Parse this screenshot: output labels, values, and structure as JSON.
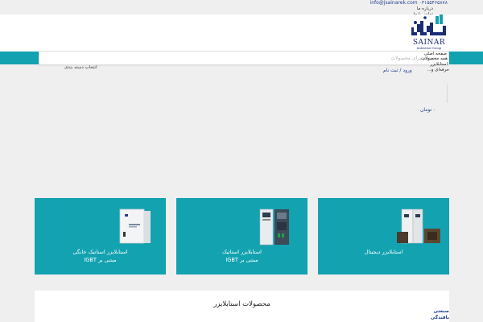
{
  "topbar": {
    "contact": "info@jsainarek.com ۰۳۱۵۵۴۶۵۸۷۸",
    "about_link": "درباره ما",
    "contact_link": "تماس با ما"
  },
  "logo": {
    "brand": "SAINAR",
    "tagline": "Industrial Group"
  },
  "search": {
    "placeholder": "جستجو برای محصولات"
  },
  "nav": {
    "home": "صفحه اصلی",
    "all_products": "همه محصولات",
    "stabilizer": "استابلایزر",
    "professional": "حرفه‌ای و..."
  },
  "category_select": "انتخاب دسته بندی",
  "signup_link": "ورود / ثبت نام",
  "cart": "۰ تومان",
  "cards": [
    {
      "title_line1": "استابلایزر استاتیک خانگی",
      "title_line2": "مبتنی بر IGBT"
    },
    {
      "title_line1": "استابلایزر استاتیک",
      "title_line2": "مبتنی بر IGBT"
    },
    {
      "title_line1": "استابلایزر دیجیتال",
      "title_line2": ""
    }
  ],
  "section": {
    "title": "محصولات استابلایزر"
  },
  "side_categories": [
    "صنعتی",
    "بافندگی"
  ],
  "colors": {
    "teal": "#13a2b0",
    "brand_blue": "#1a2d75",
    "link_blue": "#1a3d8f"
  }
}
